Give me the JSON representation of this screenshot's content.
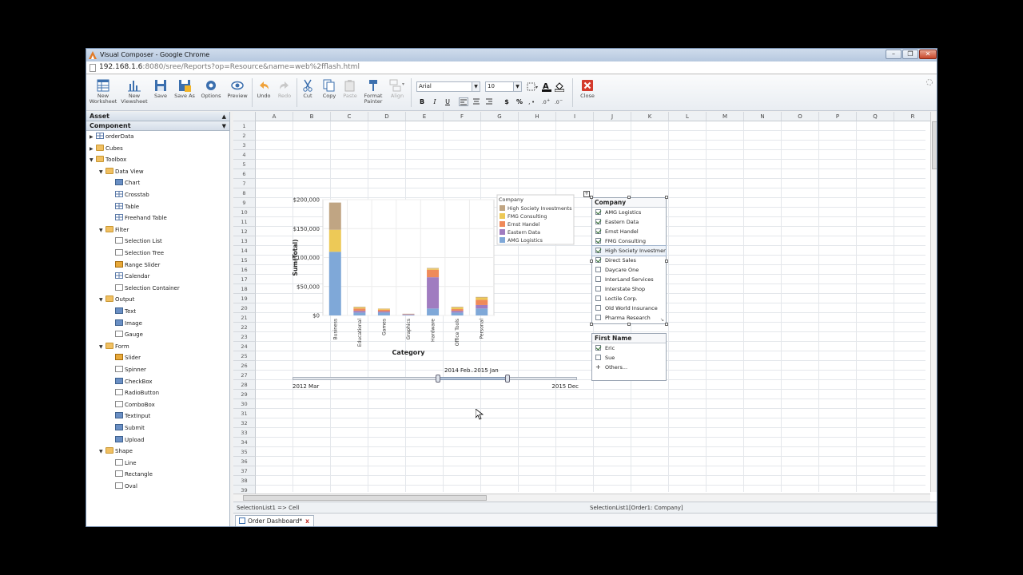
{
  "window": {
    "title": "Visual Composer - Google Chrome",
    "url_host": "192.168.1.6",
    "url_rest": ":8080/sree/Reports?op=Resource&name=web%2fflash.html"
  },
  "toolbar": {
    "new_worksheet": [
      "New",
      "Worksheet"
    ],
    "new_viewsheet": [
      "New",
      "Viewsheet"
    ],
    "save": "Save",
    "save_as": "Save As",
    "options": "Options",
    "preview": "Preview",
    "undo": "Undo",
    "redo": "Redo",
    "cut": "Cut",
    "copy": "Copy",
    "paste": "Paste",
    "format_painter": [
      "Format",
      "Painter"
    ],
    "align": "Align",
    "font_family": "Arial",
    "font_size": "10",
    "close": "Close",
    "bold": "B",
    "italic": "I",
    "underline": "U",
    "currency": "$",
    "percent": "%"
  },
  "panel": {
    "asset": "Asset",
    "component": "Component",
    "tree": [
      {
        "label": "orderData",
        "level": 0,
        "toggle": "▶",
        "icon": "grid"
      },
      {
        "label": "Cubes",
        "level": 0,
        "toggle": "▶",
        "icon": "folder"
      },
      {
        "label": "Toolbox",
        "level": 0,
        "toggle": "▼",
        "icon": "folder"
      },
      {
        "label": "Data View",
        "level": 1,
        "toggle": "▼",
        "icon": "folder"
      },
      {
        "label": "Chart",
        "level": 2,
        "toggle": "",
        "icon": "blue"
      },
      {
        "label": "Crosstab",
        "level": 2,
        "toggle": "",
        "icon": "grid"
      },
      {
        "label": "Table",
        "level": 2,
        "toggle": "",
        "icon": "grid"
      },
      {
        "label": "Freehand Table",
        "level": 2,
        "toggle": "",
        "icon": "grid"
      },
      {
        "label": "Filter",
        "level": 1,
        "toggle": "▼",
        "icon": "folder"
      },
      {
        "label": "Selection List",
        "level": 2,
        "toggle": "",
        "icon": "gray"
      },
      {
        "label": "Selection Tree",
        "level": 2,
        "toggle": "",
        "icon": "gray"
      },
      {
        "label": "Range Slider",
        "level": 2,
        "toggle": "",
        "icon": "cube"
      },
      {
        "label": "Calendar",
        "level": 2,
        "toggle": "",
        "icon": "grid"
      },
      {
        "label": "Selection Container",
        "level": 2,
        "toggle": "",
        "icon": "gray"
      },
      {
        "label": "Output",
        "level": 1,
        "toggle": "▼",
        "icon": "folder"
      },
      {
        "label": "Text",
        "level": 2,
        "toggle": "",
        "icon": "blue"
      },
      {
        "label": "Image",
        "level": 2,
        "toggle": "",
        "icon": "blue"
      },
      {
        "label": "Gauge",
        "level": 2,
        "toggle": "",
        "icon": "gray"
      },
      {
        "label": "Form",
        "level": 1,
        "toggle": "▼",
        "icon": "folder"
      },
      {
        "label": "Slider",
        "level": 2,
        "toggle": "",
        "icon": "cube"
      },
      {
        "label": "Spinner",
        "level": 2,
        "toggle": "",
        "icon": "gray"
      },
      {
        "label": "CheckBox",
        "level": 2,
        "toggle": "",
        "icon": "blue"
      },
      {
        "label": "RadioButton",
        "level": 2,
        "toggle": "",
        "icon": "gray"
      },
      {
        "label": "ComboBox",
        "level": 2,
        "toggle": "",
        "icon": "gray"
      },
      {
        "label": "TextInput",
        "level": 2,
        "toggle": "",
        "icon": "blue"
      },
      {
        "label": "Submit",
        "level": 2,
        "toggle": "",
        "icon": "blue"
      },
      {
        "label": "Upload",
        "level": 2,
        "toggle": "",
        "icon": "blue"
      },
      {
        "label": "Shape",
        "level": 1,
        "toggle": "▼",
        "icon": "folder"
      },
      {
        "label": "Line",
        "level": 2,
        "toggle": "",
        "icon": "gray"
      },
      {
        "label": "Rectangle",
        "level": 2,
        "toggle": "",
        "icon": "gray"
      },
      {
        "label": "Oval",
        "level": 2,
        "toggle": "",
        "icon": "gray"
      }
    ]
  },
  "sheet": {
    "columns": [
      "A",
      "B",
      "C",
      "D",
      "E",
      "F",
      "G",
      "H",
      "I",
      "J",
      "K",
      "L",
      "M",
      "N",
      "O",
      "P",
      "Q",
      "R"
    ],
    "rows": [
      "1",
      "2",
      "3",
      "4",
      "5",
      "6",
      "7",
      "8",
      "9",
      "10",
      "11",
      "12",
      "13",
      "14",
      "15",
      "16",
      "17",
      "18",
      "19",
      "20",
      "21",
      "22",
      "23",
      "24",
      "25",
      "26",
      "27",
      "28",
      "29",
      "30",
      "31",
      "32",
      "33",
      "34",
      "35",
      "36",
      "37",
      "38",
      "39"
    ]
  },
  "chart_data": {
    "type": "bar",
    "stacked": true,
    "categories": [
      "Business",
      "Educational",
      "Games",
      "Graphics",
      "Hardware",
      "Office Tools",
      "Personal"
    ],
    "series": [
      {
        "name": "AMG Logistics",
        "color": "#7fa8d8",
        "values": [
          110000,
          5000,
          5000,
          1000,
          12000,
          5000,
          12000
        ]
      },
      {
        "name": "Eastern Data",
        "color": "#a07cc0",
        "values": [
          0,
          3000,
          2000,
          1000,
          54000,
          3000,
          6000
        ]
      },
      {
        "name": "Ernst Handel",
        "color": "#ef8a5a",
        "values": [
          0,
          4000,
          3000,
          500,
          13000,
          3000,
          9000
        ]
      },
      {
        "name": "FMG Consulting",
        "color": "#edc957",
        "values": [
          38000,
          2000,
          1500,
          300,
          2000,
          3000,
          4000
        ]
      },
      {
        "name": "High Society Investments",
        "color": "#c0a583",
        "values": [
          47000,
          1000,
          500,
          200,
          1000,
          1000,
          1000
        ]
      }
    ],
    "legend_title": "Company",
    "legend_order": [
      "High Society Investments",
      "FMG Consulting",
      "Ernst Handel",
      "Eastern Data",
      "AMG Logistics"
    ],
    "y_ticks": [
      "$200,000",
      "$150,000",
      "$100,000",
      "$50,000",
      "$0"
    ],
    "y_tick_values": [
      200000,
      150000,
      100000,
      50000,
      0
    ],
    "xlabel": "Category",
    "ylabel": "Sum(Total)",
    "ylim": [
      0,
      200000
    ],
    "legend_position": "right"
  },
  "range_slider": {
    "selected": "2014 Feb..2015 Jan",
    "min_label": "2012 Mar",
    "max_label": "2015 Dec"
  },
  "company_list": {
    "title": "Company",
    "items": [
      {
        "label": "AMG Logistics",
        "checked": true
      },
      {
        "label": "Eastern Data",
        "checked": true
      },
      {
        "label": "Ernst Handel",
        "checked": true
      },
      {
        "label": "FMG Consulting",
        "checked": true
      },
      {
        "label": "High Society Investments",
        "checked": true
      },
      {
        "label": "Direct Sales",
        "checked": true
      },
      {
        "label": "Daycare One",
        "checked": false
      },
      {
        "label": "InterLand Services",
        "checked": false
      },
      {
        "label": "Interstate Shop",
        "checked": false
      },
      {
        "label": "Loctile Corp.",
        "checked": false
      },
      {
        "label": "Old World Insurance",
        "checked": false
      },
      {
        "label": "Pharma Research",
        "checked": false
      }
    ]
  },
  "firstname_list": {
    "title": "First Name",
    "items": [
      {
        "label": "Eric",
        "checked": true
      },
      {
        "label": "Sue",
        "checked": false
      }
    ],
    "others": "Others..."
  },
  "status": {
    "left": "SelectionList1 => Cell",
    "right": "SelectionList1[Order1: Company]"
  },
  "tab": {
    "label": "Order Dashboard*",
    "close": "x"
  }
}
